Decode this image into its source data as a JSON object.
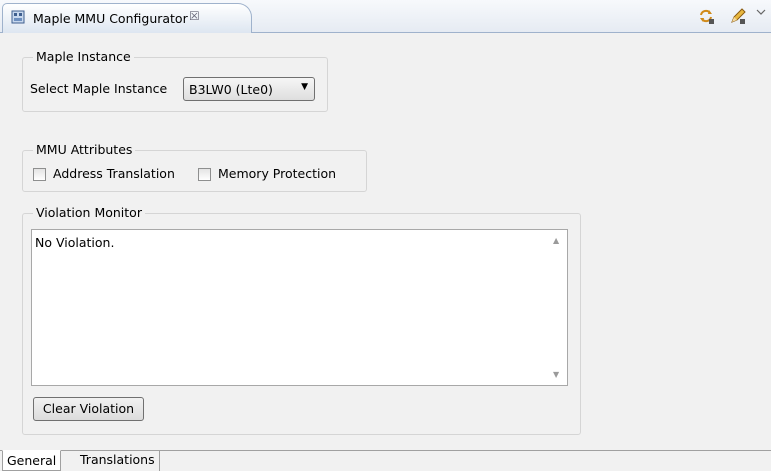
{
  "tab": {
    "title": "Maple MMU Configurator",
    "close_glyph": "☒",
    "icon": "configurator-icon"
  },
  "toolbar": {
    "sync_icon": "sync-icon",
    "edit_icon": "pencil-icon",
    "menu_icon": "view-menu-chevron-icon"
  },
  "maple_instance": {
    "legend": "Maple Instance",
    "select_label": "Select Maple Instance",
    "selected_value": "B3LW0 (Lte0)"
  },
  "mmu_attributes": {
    "legend": "MMU Attributes",
    "address_translation": {
      "label": "Address Translation",
      "checked": false
    },
    "memory_protection": {
      "label": "Memory Protection",
      "checked": false
    }
  },
  "violation_monitor": {
    "legend": "Violation Monitor",
    "text": "No Violation.",
    "clear_button": "Clear Violation"
  },
  "bottom_tabs": [
    {
      "label": "General",
      "active": true
    },
    {
      "label": "Translations",
      "active": false
    }
  ]
}
